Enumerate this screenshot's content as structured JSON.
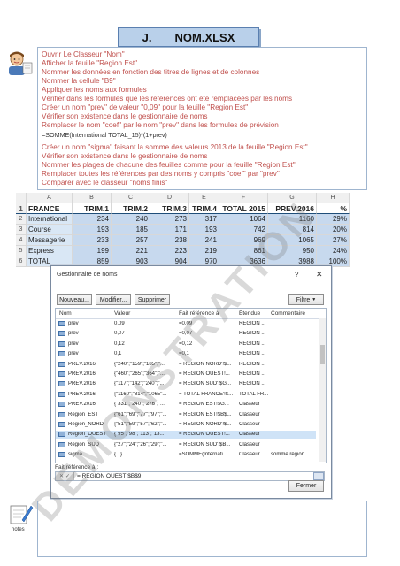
{
  "header": {
    "letter": "J.",
    "title": "NOM.XLSX"
  },
  "instructions": [
    "Ouvrir Le Classeur \"Nom\"",
    "Afficher la feuille \"Region Est\"",
    "Nommer les données en fonction des titres de lignes et de colonnes",
    "Nommer la cellule \"B9\"",
    "Appliquer les noms aux formules",
    "Vérifier dans les formules que les références ont été remplacées par les noms",
    "Créer un nom \"prev\" de valeur \"0,09\" pour la feuille \"Region Est\"",
    "Vérifier son existence dans le gestionnaire de noms",
    "Remplacer le nom \"coef\" par le nom \"prev\" dans les formules de prévision",
    "=SOMME(International TOTAL_15)*(1+prev)",
    "Créer un nom \"sigma\" faisant la somme des valeurs 2013 de la feuille \"Region Est\"",
    "Vérifier son existence dans le gestionnaire de noms",
    "Nommer les plages de chacune des feuilles comme pour la feuille \"Region Est\"",
    "Remplacer toutes les références par des noms y compris \"coef\" par \"prev\"",
    "Comparer avec le classeur \"noms finis\""
  ],
  "sheet": {
    "col_letters": [
      "A",
      "B",
      "C",
      "D",
      "E",
      "F",
      "G",
      "H"
    ],
    "row_numbers": [
      "1",
      "2",
      "3",
      "4",
      "5",
      "6"
    ],
    "rows": [
      [
        "FRANCE",
        "TRIM.1",
        "TRIM.2",
        "TRIM.3",
        "TRIM.4",
        "TOTAL 2015",
        "PREV.2016",
        "%"
      ],
      [
        "International",
        "234",
        "240",
        "273",
        "317",
        "1064",
        "1160",
        "29%"
      ],
      [
        "Course",
        "193",
        "185",
        "171",
        "193",
        "742",
        "814",
        "20%"
      ],
      [
        "Messagerie",
        "233",
        "257",
        "238",
        "241",
        "969",
        "1065",
        "27%"
      ],
      [
        "Express",
        "199",
        "221",
        "223",
        "219",
        "861",
        "950",
        "24%"
      ],
      [
        "TOTAL",
        "859",
        "903",
        "904",
        "970",
        "3636",
        "3988",
        "100%"
      ]
    ]
  },
  "dialog": {
    "title": "Gestionnaire de noms",
    "help": "?",
    "close": "✕",
    "buttons": {
      "new": "Nouveau...",
      "edit": "Modifier...",
      "delete": "Supprimer",
      "filter": "Filtre"
    },
    "columns": [
      "Nom",
      "Valeur",
      "Fait référence à",
      "Étendue",
      "Commentaire"
    ],
    "rows": [
      [
        "prev",
        "0,09",
        "=0,09",
        "REGION ...",
        ""
      ],
      [
        "prev",
        "0,07",
        "=0,07",
        "REGION ...",
        ""
      ],
      [
        "prev",
        "0,12",
        "=0,12",
        "REGION ...",
        ""
      ],
      [
        "prev",
        "0,1",
        "=0,1",
        "REGION ...",
        ""
      ],
      [
        "PREV.2016",
        "{\"240\";\"159\";\"185\";\"...",
        "= REGION NORD'!$...",
        "REGION ...",
        ""
      ],
      [
        "PREV.2016",
        "{\"460\";\"265\";\"364\";\"...",
        "= REGION OUEST!...",
        "REGION ...",
        ""
      ],
      [
        "PREV.2016",
        "{\"117\";\"142\";\"240\";\"...",
        "= REGION SUD'!$G...",
        "REGION ...",
        ""
      ],
      [
        "PREV.2016",
        "{\"1160\";\"814\";\"1065\"...",
        "= TOTAL FRANCE'!$...",
        "TOTAL FR...",
        ""
      ],
      [
        "PREV.2016",
        "{\"331\";\"240\";\"276\";\"...",
        "= REGION EST!$G...",
        "Classeur",
        ""
      ],
      [
        "Région_EST",
        "{\"61\";\"69\";\"77\";\"97\";\"...",
        "= REGION EST!$B$...",
        "Classeur",
        ""
      ],
      [
        "Région_NORD",
        "{\"51\";\"59\";\"57\";\"62\";\"...",
        "= REGION NORD'!$...",
        "Classeur",
        ""
      ],
      [
        "Région_OUEST",
        "{\"95\";\"98\";\"113\";\"13...",
        "= REGION OUEST!...",
        "Classeur",
        ""
      ],
      [
        "Région_SUD",
        "{\"27\";\"24\";\"26\";\"29\";\"...",
        "= REGION SUD'!$B...",
        "Classeur",
        ""
      ],
      [
        "sigma",
        "{...}",
        "=SOMME(Internati...",
        "Classeur",
        "somme région ..."
      ]
    ],
    "selected_index": 11,
    "ref_label": "Fait référence à :",
    "ref_value": "= REGION OUEST!$B$9",
    "close_button": "Fermer"
  },
  "watermark": "DEMONSTRATION",
  "notes": {
    "label": "notes"
  },
  "colors": {
    "instruction_text": "#c0504d",
    "header_bg": "#b9d0ea",
    "box_border": "#9fb5cf"
  }
}
